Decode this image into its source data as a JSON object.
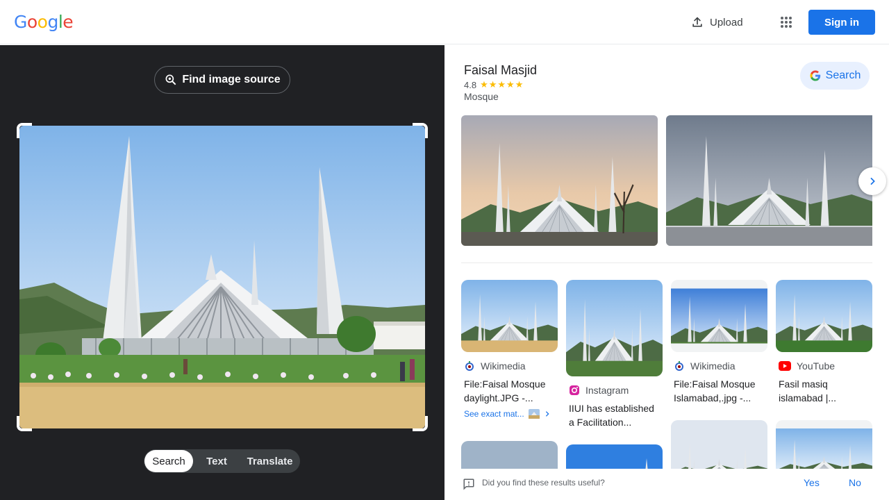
{
  "header": {
    "logo_letters": [
      "G",
      "o",
      "o",
      "g",
      "l",
      "e"
    ],
    "upload_label": "Upload",
    "signin_label": "Sign in"
  },
  "left": {
    "find_source_label": "Find image source",
    "modes": [
      "Search",
      "Text",
      "Translate"
    ],
    "active_mode": "Search"
  },
  "entity": {
    "title": "Faisal Masjid",
    "rating": "4.8",
    "stars": "★★★★★",
    "type": "Mosque",
    "search_label": "Search"
  },
  "results": [
    {
      "source": "Wikimedia",
      "caption_line1": "File:Faisal Mosque",
      "caption_line2": "daylight.JPG -...",
      "see_exact": "See exact mat..."
    },
    {
      "source": "Instagram",
      "caption_line1": "IIUI has established",
      "caption_line2": "a Facilitation..."
    },
    {
      "source": "Wikimedia",
      "caption_line1": "File:Faisal Mosque",
      "caption_line2": "Islamabad,.jpg -..."
    },
    {
      "source": "YouTube",
      "caption_line1": "Fasil masiq",
      "caption_line2": "islamabad |..."
    }
  ],
  "feedback": {
    "question": "Did you find these results useful?",
    "yes": "Yes",
    "no": "No"
  },
  "colors": {
    "accent": "#1a73e8",
    "dark_panel": "#202124"
  }
}
